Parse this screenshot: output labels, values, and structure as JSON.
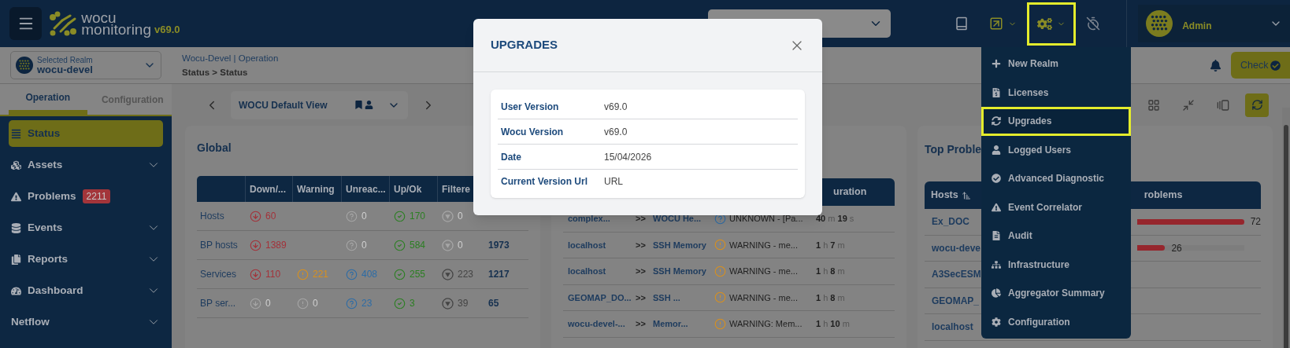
{
  "header": {
    "logo_top": "wocu",
    "logo_bottom": "monitoring",
    "version": "v69.0",
    "user": "Admin",
    "toolbar": [
      {
        "kind": "book",
        "caret": false,
        "highlighted": false
      },
      {
        "kind": "external",
        "caret": true,
        "highlighted": false
      },
      {
        "kind": "gears",
        "caret": true,
        "highlighted": true
      },
      {
        "kind": "history-off",
        "caret": false,
        "highlighted": false
      }
    ]
  },
  "realm": {
    "label": "Selected Realm",
    "value": "wocu-devel"
  },
  "breadcrumb": {
    "context": "Wocu-Devel | Operation",
    "path": "Status > Status"
  },
  "check_button": "Check",
  "sidebar": {
    "tabs": [
      {
        "label": "Operation",
        "selected": true
      },
      {
        "label": "Configuration",
        "selected": false
      }
    ],
    "items": [
      {
        "label": "Status",
        "kind": "list",
        "selected": true,
        "expandable": false
      },
      {
        "label": "Assets",
        "kind": "cubes",
        "selected": false,
        "expandable": true
      },
      {
        "label": "Problems",
        "kind": "warning",
        "selected": false,
        "expandable": false,
        "badge": "2211"
      },
      {
        "label": "Events",
        "kind": "database",
        "selected": false,
        "expandable": true
      },
      {
        "label": "Reports",
        "kind": "file",
        "selected": false,
        "expandable": true
      },
      {
        "label": "Dashboard",
        "kind": "gauge",
        "selected": false,
        "expandable": true
      },
      {
        "label": "Netflow",
        "kind": "plain",
        "selected": false,
        "expandable": true
      }
    ]
  },
  "view": {
    "name": "WOCU Default View"
  },
  "global": {
    "title": "Global",
    "columns": [
      "Down/...",
      "Warning",
      "Unreac...",
      "Up/Ok",
      "Filtere"
    ],
    "rows": [
      {
        "label": "Hosts",
        "cells": [
          {
            "kind": "down",
            "value": "60",
            "muted": false
          },
          {
            "kind": "blank"
          },
          {
            "kind": "unknown",
            "value": "0",
            "muted": true
          },
          {
            "kind": "up",
            "value": "170",
            "muted": false
          },
          {
            "kind": "filtered",
            "value": "0",
            "muted": true
          }
        ]
      },
      {
        "label": "BP hosts",
        "total": "1973",
        "cells": [
          {
            "kind": "down",
            "value": "1389",
            "muted": false
          },
          {
            "kind": "blank"
          },
          {
            "kind": "unknown",
            "value": "0",
            "muted": true
          },
          {
            "kind": "up",
            "value": "584",
            "muted": false
          },
          {
            "kind": "filtered",
            "value": "0",
            "muted": true
          }
        ]
      },
      {
        "label": "Services",
        "total": "1217",
        "cells": [
          {
            "kind": "down",
            "value": "110",
            "muted": false
          },
          {
            "kind": "warning",
            "value": "221",
            "muted": false
          },
          {
            "kind": "unknown",
            "value": "408",
            "muted": false
          },
          {
            "kind": "up",
            "value": "255",
            "muted": false
          },
          {
            "kind": "filtered",
            "value": "223",
            "muted": false
          }
        ]
      },
      {
        "label": "BP ser...",
        "total": "65",
        "cells": [
          {
            "kind": "down",
            "value": "0",
            "muted": true
          },
          {
            "kind": "warning",
            "value": "0",
            "muted": true
          },
          {
            "kind": "unknown",
            "value": "23",
            "muted": false
          },
          {
            "kind": "up",
            "value": "3",
            "muted": false
          },
          {
            "kind": "filtered",
            "value": "39",
            "muted": false
          }
        ]
      }
    ]
  },
  "problems": {
    "column": "uration",
    "rows": [
      {
        "host": "complex...",
        "separator": ">>",
        "service": "WOCU He...",
        "kind": "unknown",
        "output": "UNKNOWN - [Pa...",
        "duration": "**40** m **19** s"
      },
      {
        "host": "localhost",
        "separator": ">>",
        "service": "SSH Memory",
        "kind": "warning",
        "output": "WARNING - me...",
        "duration": "**1** h **7** m"
      },
      {
        "host": "localhost",
        "separator": ">>",
        "service": "SSH Memory",
        "kind": "warning",
        "output": "WARNING - me...",
        "duration": "**1** h **8** m"
      },
      {
        "host": "GEOMAP_DO...",
        "separator": ">>",
        "service": "SSH ...",
        "kind": "warning",
        "output": "WARNING - me...",
        "duration": "**1** h **8** m"
      },
      {
        "host": "wocu-devel-...",
        "separator": ">>",
        "service": "Memor...",
        "kind": "warning",
        "output": "WARNING: Mem...",
        "duration": "**1** h **10** m"
      }
    ]
  },
  "top_problems": {
    "title": "Top Proble",
    "columns": [
      "Hosts",
      "roblems"
    ],
    "rows": [
      {
        "host": "Ex_DOC",
        "level": 1,
        "count": "72"
      },
      {
        "host": "wocu-deve",
        "level": 0.26,
        "count": "26"
      },
      {
        "host": "A3SecESM"
      },
      {
        "host": "GEOMAP_"
      },
      {
        "host": "localhost"
      }
    ]
  },
  "menu": [
    {
      "label": "New Realm",
      "kind": "plus",
      "highlighted": false
    },
    {
      "label": "Licenses",
      "kind": "license",
      "highlighted": false
    },
    {
      "label": "Upgrades",
      "kind": "sync",
      "highlighted": true
    },
    {
      "label": "Logged Users",
      "kind": "user",
      "highlighted": false
    },
    {
      "label": "Advanced Diagnostic",
      "kind": "check",
      "highlighted": false
    },
    {
      "label": "Event Correlator",
      "kind": "warning",
      "highlighted": false
    },
    {
      "label": "Audit",
      "kind": "doc",
      "highlighted": false
    },
    {
      "label": "Infrastructure",
      "kind": "sitemap",
      "highlighted": false
    },
    {
      "label": "Aggregator Summary",
      "kind": "pie",
      "highlighted": false
    },
    {
      "label": "Configuration",
      "kind": "cog",
      "highlighted": false
    }
  ],
  "modal": {
    "title": "UPGRADES",
    "rows": [
      {
        "label": "User Version",
        "value": "v69.0"
      },
      {
        "label": "Wocu Version",
        "value": "v69.0"
      },
      {
        "label": "Date",
        "value": "15/04/2026"
      },
      {
        "label": "Current Version Url",
        "value": "URL"
      }
    ]
  }
}
